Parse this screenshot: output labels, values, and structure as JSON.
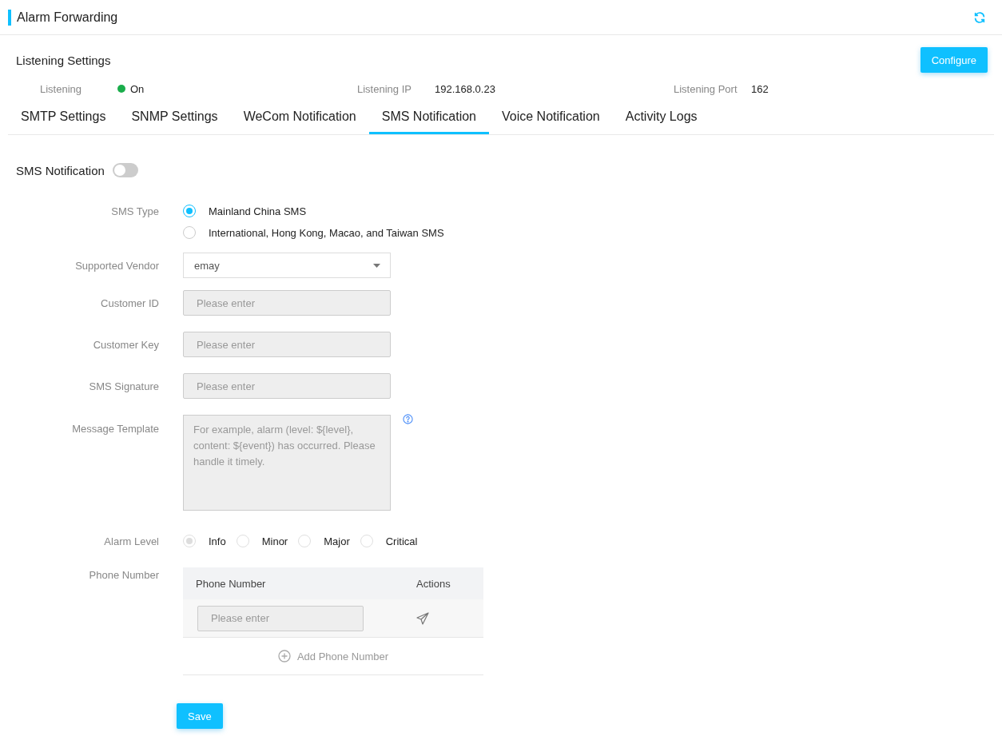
{
  "header": {
    "title": "Alarm Forwarding"
  },
  "listening": {
    "title": "Listening Settings",
    "configure_button": "Configure",
    "fields": [
      {
        "label": "Listening",
        "kind": "status",
        "on": true,
        "value": "On"
      },
      {
        "label": "Listening IP",
        "kind": "text",
        "value": "192.168.0.23"
      },
      {
        "label": "Listening Port",
        "kind": "text",
        "value": "162"
      }
    ]
  },
  "tabs": [
    {
      "label": "SMTP Settings",
      "selected": false
    },
    {
      "label": "SNMP Settings",
      "selected": false
    },
    {
      "label": "WeCom Notification",
      "selected": false
    },
    {
      "label": "SMS Notification",
      "selected": true
    },
    {
      "label": "Voice Notification",
      "selected": false
    },
    {
      "label": "Activity Logs",
      "selected": false
    }
  ],
  "sms_notification": {
    "label": "SMS Notification",
    "on": false
  },
  "sms_type": {
    "label": "SMS Type",
    "options": [
      {
        "label": "Mainland China SMS",
        "selected": true
      },
      {
        "label": "International, Hong Kong, Macao, and Taiwan SMS",
        "selected": false
      }
    ]
  },
  "vendor": {
    "label": "Supported Vendor",
    "value": "emay"
  },
  "inputs": [
    {
      "label": "Customer ID",
      "placeholder": "Please enter",
      "disabled": true
    },
    {
      "label": "Customer Key",
      "placeholder": "Please enter",
      "disabled": true
    },
    {
      "label": "SMS Signature",
      "placeholder": "Please enter",
      "disabled": true
    }
  ],
  "template": {
    "label": "Message Template",
    "placeholder": "For example, alarm (level: ${level}, content: ${event}) has occurred. Please handle it timely.",
    "disabled": true
  },
  "alarm_level": {
    "label": "Alarm Level",
    "disabled": true,
    "options": [
      {
        "label": "Info",
        "selected": true
      },
      {
        "label": "Minor",
        "selected": false
      },
      {
        "label": "Major",
        "selected": false
      },
      {
        "label": "Critical",
        "selected": false
      }
    ]
  },
  "phone": {
    "label": "Phone Number",
    "columns": [
      "Phone Number",
      "Actions"
    ],
    "rows": [
      {
        "placeholder": "Please enter",
        "disabled": true
      }
    ],
    "add_label": "Add Phone Number"
  },
  "save_button": "Save"
}
